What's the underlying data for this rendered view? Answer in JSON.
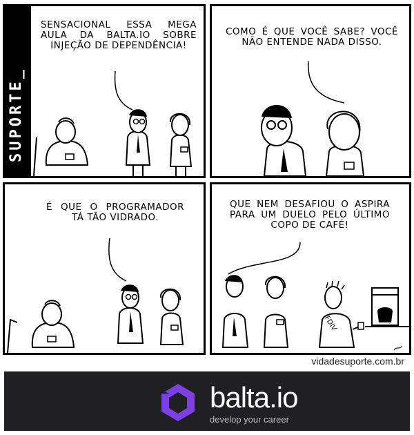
{
  "comic": {
    "series_label": "SUPORTE_",
    "panels": [
      {
        "speech": "Sensacional essa mega aula da balta.io sobre injeção de dependência!"
      },
      {
        "speech": "Como é que você sabe? Você não entende nada disso."
      },
      {
        "speech": "É que o programador tá tão vidrado."
      },
      {
        "speech": "Que nem desafiou o aspira para um duelo pelo último copo de café!"
      }
    ],
    "shirt_text": "FDIV",
    "credit": "vidadesuporte.com.br"
  },
  "banner": {
    "brand": "balta.io",
    "tagline": "develop your career",
    "accent_color": "#7b3fe4",
    "background_color": "#1f1f24"
  }
}
